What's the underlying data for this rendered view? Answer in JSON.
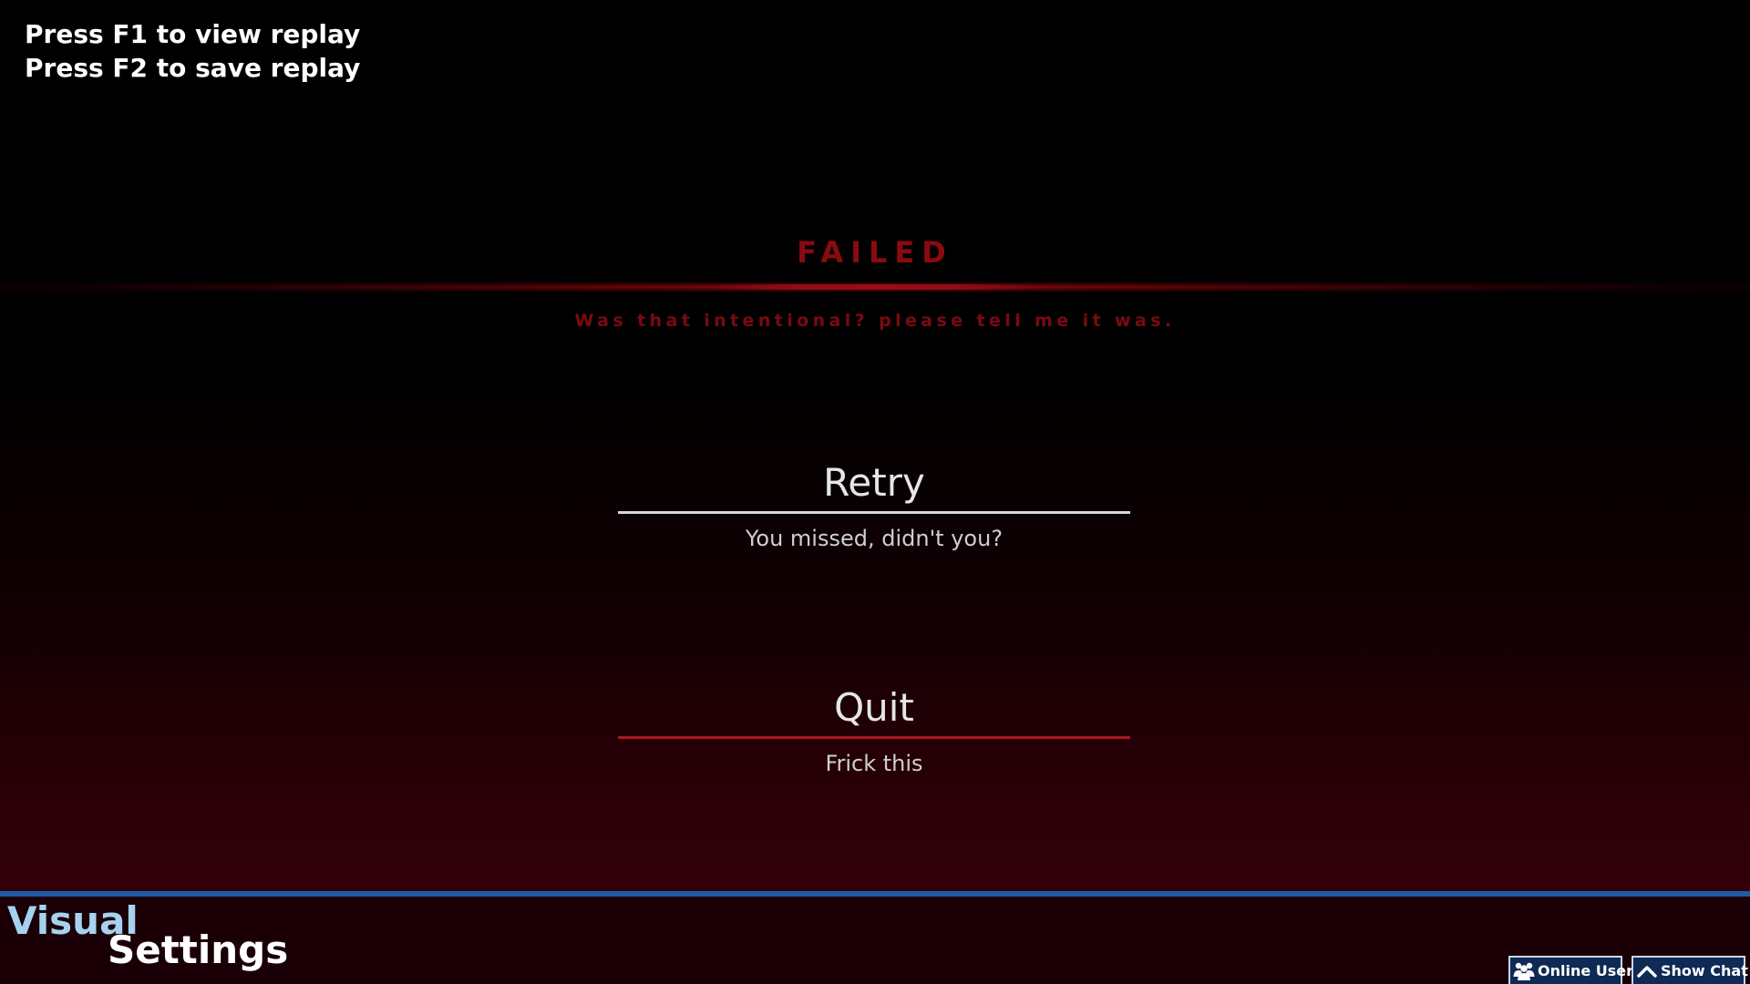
{
  "replay_hints": {
    "view": "Press F1 to view replay",
    "save": "Press F2 to save replay"
  },
  "fail_screen": {
    "title": "FAILED",
    "subtitle": "Was that intentional? please tell me it was."
  },
  "menu": {
    "retry": {
      "label": "Retry",
      "description": "You missed, didn't you?"
    },
    "quit": {
      "label": "Quit",
      "description": "Frick this"
    }
  },
  "bottom_bar": {
    "settings_line1": "Visual",
    "settings_line2": "Settings",
    "online_users_label": "Online Users",
    "show_chat_label": "Show Chat",
    "icons": [
      "users-icon",
      "chevron-up-icon"
    ]
  },
  "colors": {
    "fail_red": "#8a0a10",
    "accent_blue": "#1d5aa8",
    "visual_label_blue": "#a6d2f0",
    "retry_underline": "#d8d8d8",
    "quit_underline": "#b01424"
  }
}
